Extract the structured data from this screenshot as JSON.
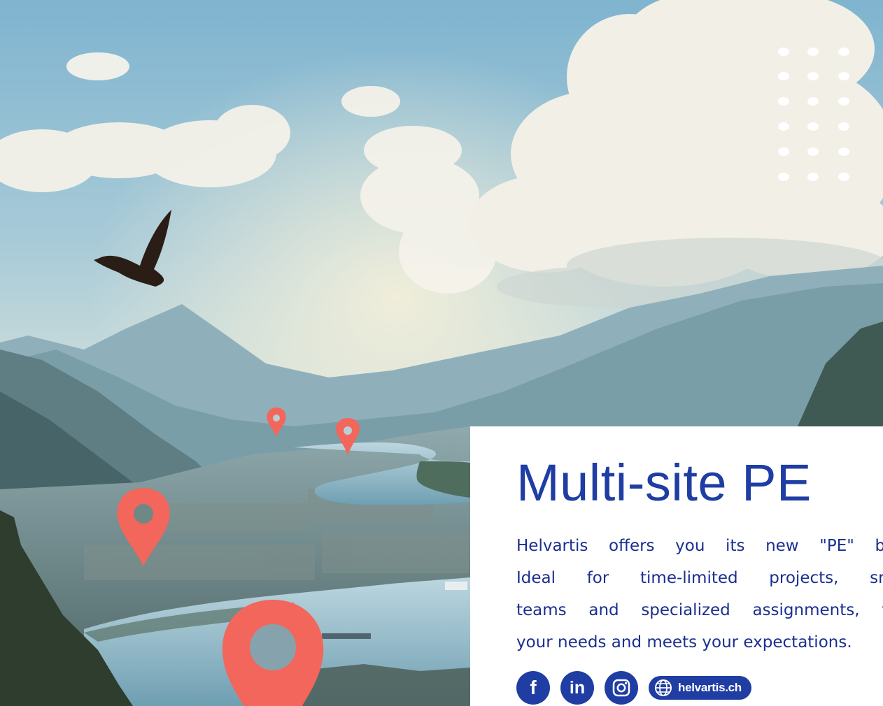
{
  "card": {
    "title": "Multi-site PE",
    "body_lines": [
      "Helvartis offers you its new \"PE\" busi",
      "Ideal for time-limited projects, smal",
      "teams and specialized assignments, the",
      "your needs and meets your expectations."
    ]
  },
  "social": {
    "facebook_label": "f",
    "linkedin_label": "in",
    "website_label": "helvartis.ch"
  },
  "colors": {
    "brand_blue": "#1f3da3",
    "pin_red": "#f2665b",
    "card_bg": "#ffffff"
  },
  "icons": [
    "facebook-icon",
    "linkedin-icon",
    "instagram-icon",
    "globe-icon",
    "location-pin-icon",
    "bird-icon"
  ]
}
